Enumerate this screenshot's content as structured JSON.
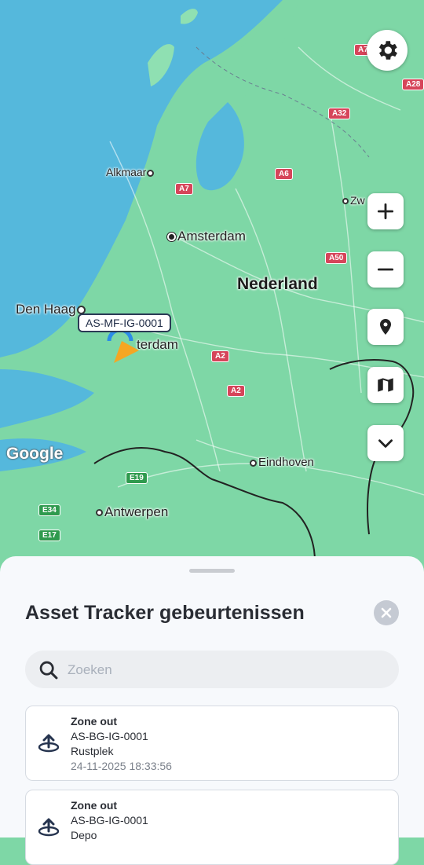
{
  "map": {
    "places": {
      "nederland": "Nederland",
      "amsterdam": "Amsterdam",
      "alkmaar": "Alkmaar",
      "den_haag": "Den Haag",
      "rotterdam": "terdam",
      "eindhoven": "Eindhoven",
      "antwerpen": "Antwerpen",
      "zwolle": "Zw"
    },
    "road_shields": {
      "a7_top": "A7",
      "a28": "A28",
      "a32": "A32",
      "a6": "A6",
      "a7": "A7",
      "a50": "A50",
      "a2_upper": "A2",
      "a2_lower": "A2",
      "e19": "E19",
      "e34": "E34",
      "e17": "E17"
    },
    "google_logo": "Google",
    "asset_label": "AS-MF-IG-0001"
  },
  "controls": {
    "settings": "gear-icon",
    "zoom_in": "plus-icon",
    "zoom_out": "minus-icon",
    "location": "location-pin-icon",
    "map_type": "map-icon",
    "collapse": "chevron-down-icon"
  },
  "sheet": {
    "title": "Asset Tracker gebeurtenissen",
    "search_placeholder": "Zoeken",
    "events": [
      {
        "type": "Zone out",
        "asset": "AS-BG-IG-0001",
        "zone": "Rustplek",
        "time": "24-11-2025 18:33:56"
      },
      {
        "type": "Zone out",
        "asset": "AS-BG-IG-0001",
        "zone": "Depo",
        "time": ""
      }
    ]
  },
  "colors": {
    "water": "#55b8dc",
    "land": "#7ed7a6",
    "road_shield": "#d6455a",
    "accent": "#2b3a55",
    "marker_orange": "#f5a623",
    "marker_blue": "#2b8de8"
  }
}
